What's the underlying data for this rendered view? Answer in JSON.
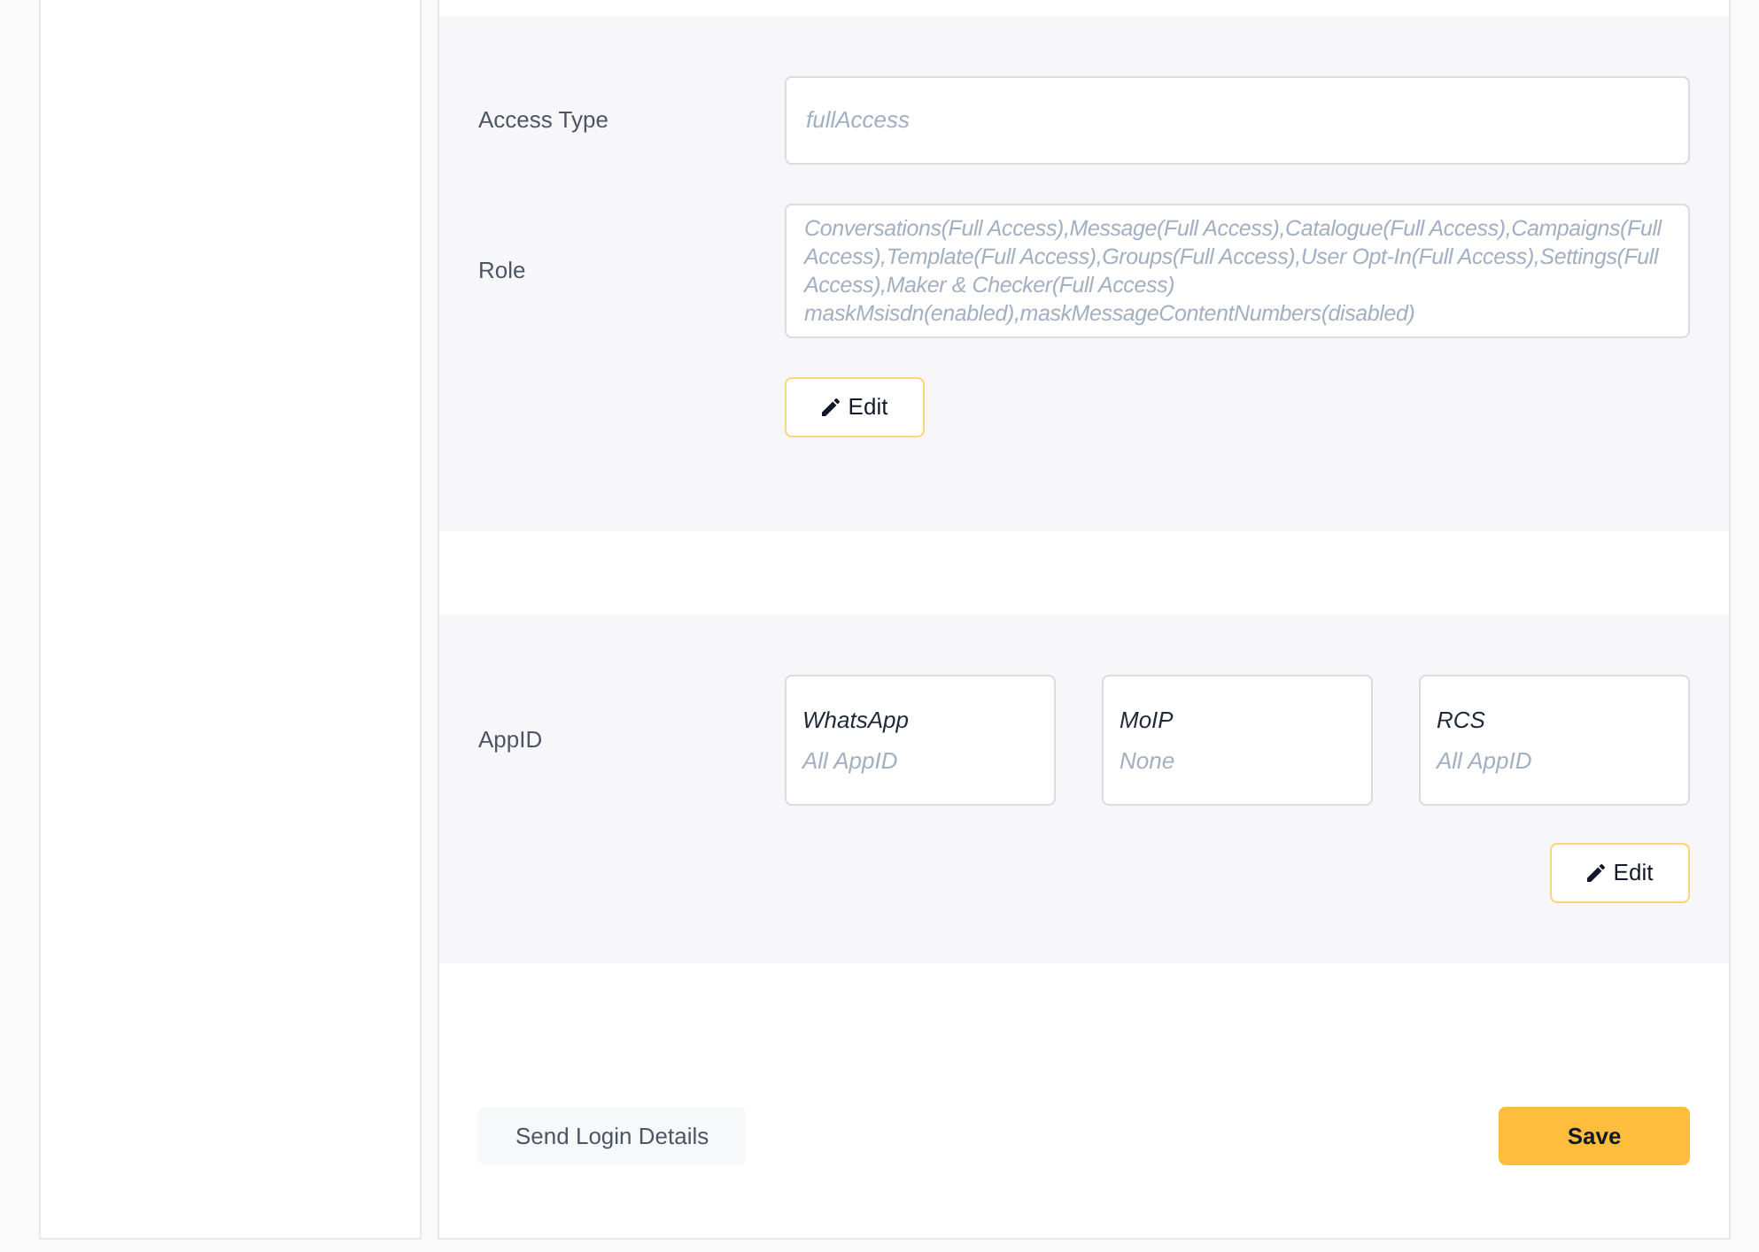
{
  "access_type": {
    "label": "Access Type",
    "value": "fullAccess"
  },
  "role": {
    "label": "Role",
    "lines": [
      "Conversations(Full Access),Message(Full Access),Catalogue(Full Access),Campaigns(Full Access),Template(Full Access),Groups(Full Access),User Opt-In(Full Access),Settings(Full Access),Maker & Checker(Full Access)",
      "maskMsisdn(enabled),maskMessageContentNumbers(disabled)"
    ],
    "edit_button": "Edit"
  },
  "app_id": {
    "label": "AppID",
    "channels": [
      {
        "name": "WhatsApp",
        "value": "All AppID"
      },
      {
        "name": "MoIP",
        "value": "None"
      },
      {
        "name": "RCS",
        "value": "All AppID"
      }
    ],
    "edit_button": "Edit"
  },
  "actions": {
    "send_login_details": "Send Login Details",
    "save": "Save"
  }
}
